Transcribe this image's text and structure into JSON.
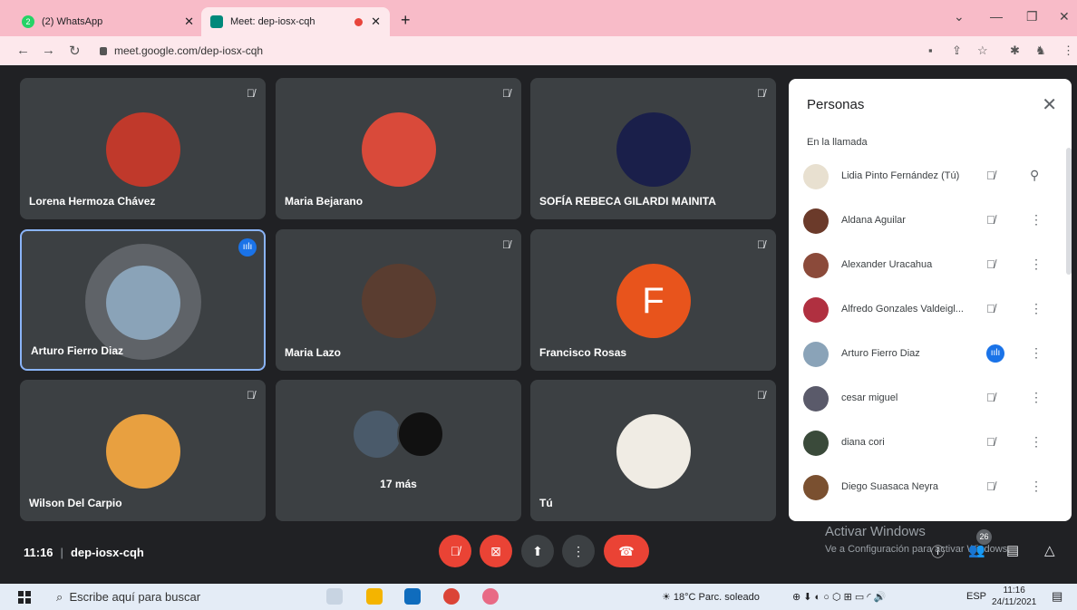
{
  "browser": {
    "tabs": [
      {
        "title": "(2) WhatsApp",
        "icon": "whatsapp-icon",
        "color": "#25d366",
        "badge": "2"
      },
      {
        "title": "Meet: dep-iosx-cqh",
        "icon": "meet-icon",
        "color": "#00897b"
      }
    ],
    "url": "meet.google.com/dep-iosx-cqh"
  },
  "tiles": [
    {
      "name": "Lorena Hermoza Chávez",
      "muted": true,
      "avatar": "#c0392b"
    },
    {
      "name": "Maria Bejarano",
      "muted": true,
      "avatar": "#d94a3a"
    },
    {
      "name": "SOFÍA REBECA GILARDI MAINITA",
      "muted": true,
      "avatar": "#1a1f4a"
    },
    {
      "name": "Arturo Fierro Diaz",
      "muted": false,
      "speaking": true,
      "avatar": "#8aa3b8"
    },
    {
      "name": "Maria Lazo",
      "muted": true,
      "avatar": "#5a3d30"
    },
    {
      "name": "Francisco Rosas",
      "muted": true,
      "letter": "F",
      "avatar": "#e8541c"
    },
    {
      "name": "Wilson Del Carpio",
      "muted": true,
      "avatar": "#e8a040"
    },
    {
      "more": "17 más"
    },
    {
      "name": "Tú",
      "muted": true,
      "avatar": "#f0ece4"
    }
  ],
  "panel": {
    "title": "Personas",
    "section": "En la llamada",
    "people": [
      {
        "name": "Lidia Pinto Fernández (Tú)",
        "avatar": "#e8e0d0",
        "muted": true,
        "pin": true
      },
      {
        "name": "Aldana Aguilar",
        "avatar": "#6b3a2a",
        "muted": true
      },
      {
        "name": "Alexander Uracahua",
        "avatar": "#8b4a3a",
        "muted": true
      },
      {
        "name": "Alfredo Gonzales Valdeigl...",
        "avatar": "#b03040",
        "muted": true
      },
      {
        "name": "Arturo Fierro Diaz",
        "avatar": "#8aa3b8",
        "muted": false,
        "speaking": true
      },
      {
        "name": "cesar miguel",
        "avatar": "#5a5a6a",
        "muted": true
      },
      {
        "name": "diana cori",
        "avatar": "#3a4a3a",
        "muted": true
      },
      {
        "name": "Diego Suasaca Neyra",
        "avatar": "#7a5030",
        "muted": true
      }
    ]
  },
  "bottom": {
    "time": "11:16",
    "meeting_code": "dep-iosx-cqh",
    "participants_count": "26",
    "activate_title": "Activar Windows",
    "activate_sub": "Ve a Configuración para activar Windows."
  },
  "taskbar": {
    "search_placeholder": "Escribe aquí para buscar",
    "weather": "18°C  Parc. soleado",
    "lang": "ESP",
    "time": "11:16",
    "date": "24/11/2021"
  }
}
